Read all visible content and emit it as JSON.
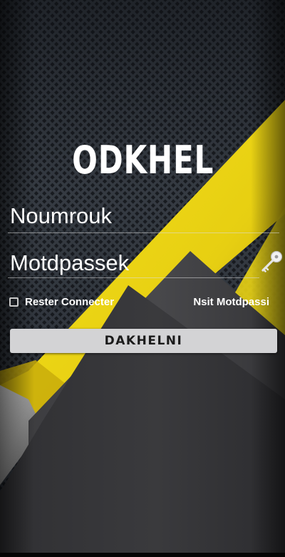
{
  "app": {
    "title": "ODKHEL"
  },
  "form": {
    "username_placeholder": "Noumrouk",
    "password_placeholder": "Motdpassek",
    "remember_label": "Rester Connecter",
    "remember_checked": false,
    "forgot_label": "Nsit Motdpassi",
    "submit_label": "DAKHELNI"
  },
  "icons": {
    "password_toggle": "key-icon",
    "remember": "checkbox"
  },
  "colors": {
    "accent_yellow": "#f1dc14",
    "background_dark": "#2b3038",
    "button_bg": "#d3d3d5",
    "text": "#ffffff"
  }
}
